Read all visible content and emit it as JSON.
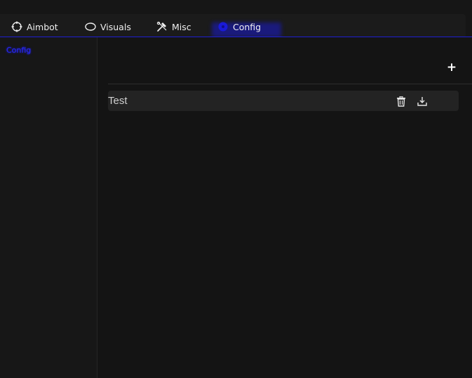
{
  "tabs": [
    {
      "label": "Aimbot",
      "icon": "crosshair-icon"
    },
    {
      "label": "Visuals",
      "icon": "eye-icon"
    },
    {
      "label": "Misc",
      "icon": "tools-icon"
    },
    {
      "label": "Config",
      "icon": "config-icon",
      "active": true
    }
  ],
  "sidebar": {
    "items": [
      {
        "label": "Config",
        "active": true
      }
    ]
  },
  "main": {
    "add_label": "+",
    "configs": [
      {
        "name": "Test",
        "actions": [
          "trash-icon",
          "download-icon"
        ]
      }
    ]
  },
  "colors": {
    "accent": "#1f1fd4",
    "background": "#141414",
    "sidebar": "#171717",
    "row": "#232323"
  }
}
